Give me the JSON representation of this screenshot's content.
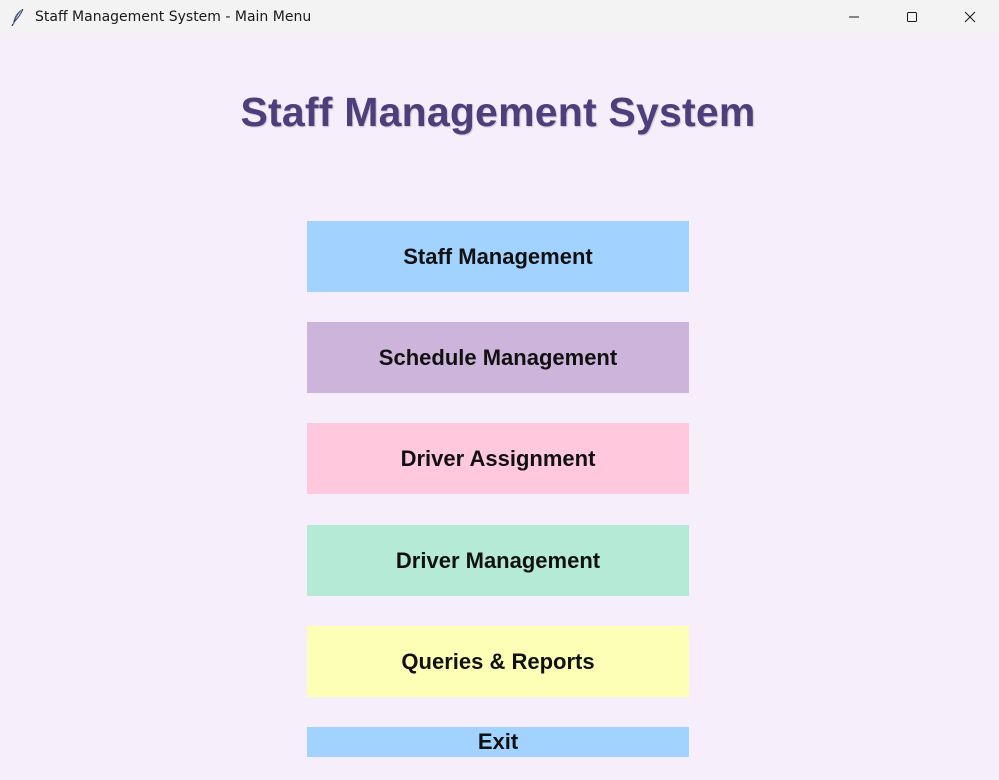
{
  "window": {
    "title": "Staff Management System - Main Menu",
    "icon": "feather-icon",
    "controls": [
      "minimize-icon",
      "maximize-icon",
      "close-icon"
    ]
  },
  "main": {
    "heading": "Staff Management System",
    "heading_color": "#4d3f7b",
    "background_color": "#f7eefb",
    "buttons": [
      {
        "label": "Staff Management",
        "color": "#a2d2ff"
      },
      {
        "label": "Schedule Management",
        "color": "#cdb4db"
      },
      {
        "label": "Driver Assignment",
        "color": "#ffc8dd"
      },
      {
        "label": "Driver Management",
        "color": "#b5ead7"
      },
      {
        "label": "Queries & Reports",
        "color": "#fdffb6"
      },
      {
        "label": "Exit",
        "color": "#a2d2ff"
      }
    ]
  }
}
